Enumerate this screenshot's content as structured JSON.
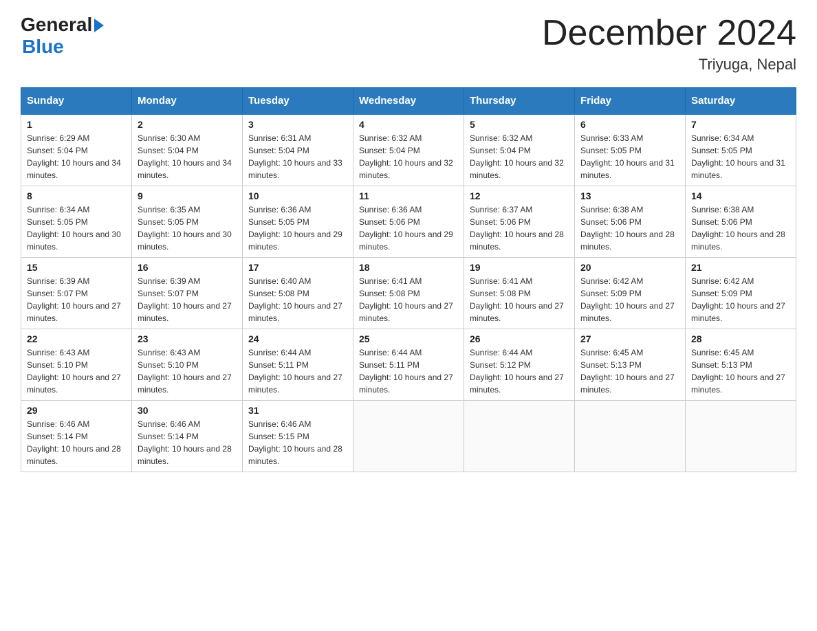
{
  "logo": {
    "line1": "General",
    "arrow": "▶",
    "line2": "Blue"
  },
  "title": "December 2024",
  "subtitle": "Triyuga, Nepal",
  "days": [
    "Sunday",
    "Monday",
    "Tuesday",
    "Wednesday",
    "Thursday",
    "Friday",
    "Saturday"
  ],
  "weeks": [
    [
      {
        "num": "1",
        "sunrise": "6:29 AM",
        "sunset": "5:04 PM",
        "daylight": "10 hours and 34 minutes."
      },
      {
        "num": "2",
        "sunrise": "6:30 AM",
        "sunset": "5:04 PM",
        "daylight": "10 hours and 34 minutes."
      },
      {
        "num": "3",
        "sunrise": "6:31 AM",
        "sunset": "5:04 PM",
        "daylight": "10 hours and 33 minutes."
      },
      {
        "num": "4",
        "sunrise": "6:32 AM",
        "sunset": "5:04 PM",
        "daylight": "10 hours and 32 minutes."
      },
      {
        "num": "5",
        "sunrise": "6:32 AM",
        "sunset": "5:04 PM",
        "daylight": "10 hours and 32 minutes."
      },
      {
        "num": "6",
        "sunrise": "6:33 AM",
        "sunset": "5:05 PM",
        "daylight": "10 hours and 31 minutes."
      },
      {
        "num": "7",
        "sunrise": "6:34 AM",
        "sunset": "5:05 PM",
        "daylight": "10 hours and 31 minutes."
      }
    ],
    [
      {
        "num": "8",
        "sunrise": "6:34 AM",
        "sunset": "5:05 PM",
        "daylight": "10 hours and 30 minutes."
      },
      {
        "num": "9",
        "sunrise": "6:35 AM",
        "sunset": "5:05 PM",
        "daylight": "10 hours and 30 minutes."
      },
      {
        "num": "10",
        "sunrise": "6:36 AM",
        "sunset": "5:05 PM",
        "daylight": "10 hours and 29 minutes."
      },
      {
        "num": "11",
        "sunrise": "6:36 AM",
        "sunset": "5:06 PM",
        "daylight": "10 hours and 29 minutes."
      },
      {
        "num": "12",
        "sunrise": "6:37 AM",
        "sunset": "5:06 PM",
        "daylight": "10 hours and 28 minutes."
      },
      {
        "num": "13",
        "sunrise": "6:38 AM",
        "sunset": "5:06 PM",
        "daylight": "10 hours and 28 minutes."
      },
      {
        "num": "14",
        "sunrise": "6:38 AM",
        "sunset": "5:06 PM",
        "daylight": "10 hours and 28 minutes."
      }
    ],
    [
      {
        "num": "15",
        "sunrise": "6:39 AM",
        "sunset": "5:07 PM",
        "daylight": "10 hours and 27 minutes."
      },
      {
        "num": "16",
        "sunrise": "6:39 AM",
        "sunset": "5:07 PM",
        "daylight": "10 hours and 27 minutes."
      },
      {
        "num": "17",
        "sunrise": "6:40 AM",
        "sunset": "5:08 PM",
        "daylight": "10 hours and 27 minutes."
      },
      {
        "num": "18",
        "sunrise": "6:41 AM",
        "sunset": "5:08 PM",
        "daylight": "10 hours and 27 minutes."
      },
      {
        "num": "19",
        "sunrise": "6:41 AM",
        "sunset": "5:08 PM",
        "daylight": "10 hours and 27 minutes."
      },
      {
        "num": "20",
        "sunrise": "6:42 AM",
        "sunset": "5:09 PM",
        "daylight": "10 hours and 27 minutes."
      },
      {
        "num": "21",
        "sunrise": "6:42 AM",
        "sunset": "5:09 PM",
        "daylight": "10 hours and 27 minutes."
      }
    ],
    [
      {
        "num": "22",
        "sunrise": "6:43 AM",
        "sunset": "5:10 PM",
        "daylight": "10 hours and 27 minutes."
      },
      {
        "num": "23",
        "sunrise": "6:43 AM",
        "sunset": "5:10 PM",
        "daylight": "10 hours and 27 minutes."
      },
      {
        "num": "24",
        "sunrise": "6:44 AM",
        "sunset": "5:11 PM",
        "daylight": "10 hours and 27 minutes."
      },
      {
        "num": "25",
        "sunrise": "6:44 AM",
        "sunset": "5:11 PM",
        "daylight": "10 hours and 27 minutes."
      },
      {
        "num": "26",
        "sunrise": "6:44 AM",
        "sunset": "5:12 PM",
        "daylight": "10 hours and 27 minutes."
      },
      {
        "num": "27",
        "sunrise": "6:45 AM",
        "sunset": "5:13 PM",
        "daylight": "10 hours and 27 minutes."
      },
      {
        "num": "28",
        "sunrise": "6:45 AM",
        "sunset": "5:13 PM",
        "daylight": "10 hours and 27 minutes."
      }
    ],
    [
      {
        "num": "29",
        "sunrise": "6:46 AM",
        "sunset": "5:14 PM",
        "daylight": "10 hours and 28 minutes."
      },
      {
        "num": "30",
        "sunrise": "6:46 AM",
        "sunset": "5:14 PM",
        "daylight": "10 hours and 28 minutes."
      },
      {
        "num": "31",
        "sunrise": "6:46 AM",
        "sunset": "5:15 PM",
        "daylight": "10 hours and 28 minutes."
      },
      null,
      null,
      null,
      null
    ]
  ]
}
